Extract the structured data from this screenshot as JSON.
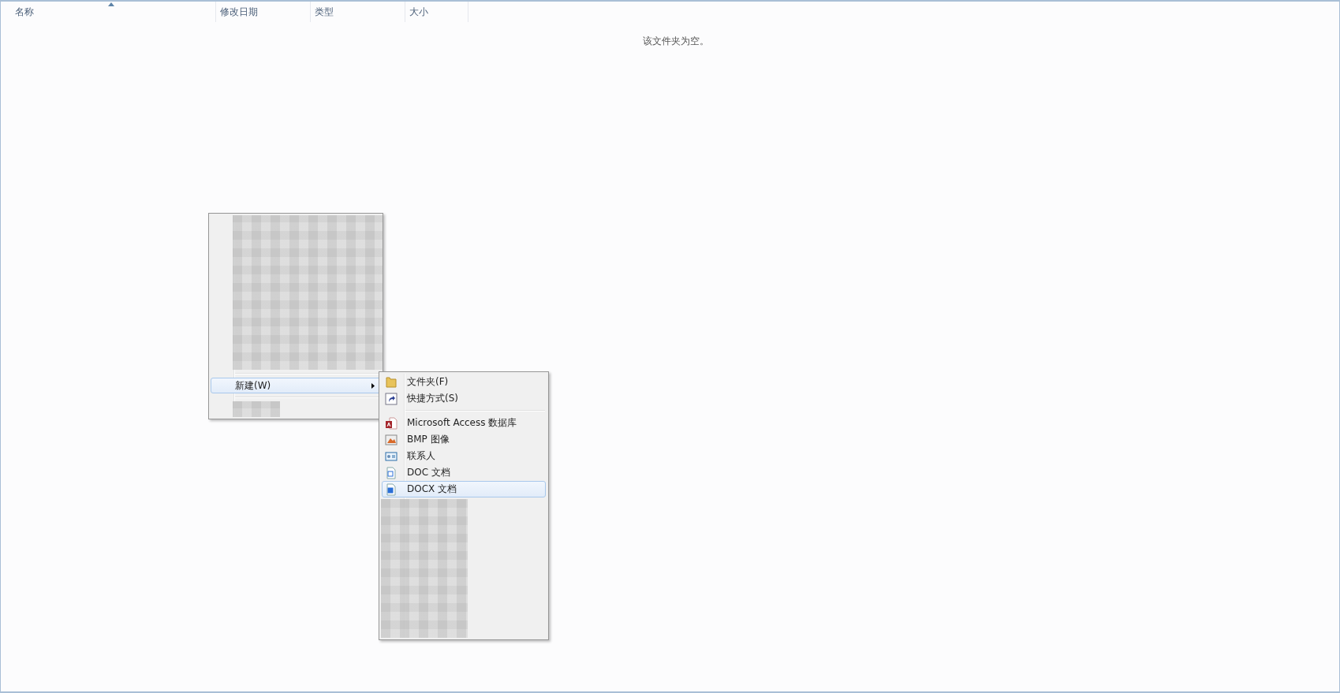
{
  "columns": [
    {
      "label": "名称",
      "sorted": true
    },
    {
      "label": "修改日期",
      "sorted": false
    },
    {
      "label": "类型",
      "sorted": false
    },
    {
      "label": "大小",
      "sorted": false
    }
  ],
  "empty_message": "该文件夹为空。",
  "context_menu": {
    "items": [
      {
        "label": "新建(W)",
        "selected": true,
        "has_submenu": true
      }
    ]
  },
  "submenu": {
    "groups": [
      [
        {
          "label": "文件夹(F)",
          "kind": "folder",
          "selected": false
        },
        {
          "label": "快捷方式(S)",
          "kind": "shortcut",
          "selected": false
        }
      ],
      [
        {
          "label": "Microsoft Access 数据库",
          "kind": "access",
          "selected": false
        },
        {
          "label": "BMP 图像",
          "kind": "bmp",
          "selected": false
        },
        {
          "label": "联系人",
          "kind": "contact",
          "selected": false
        },
        {
          "label": "DOC 文档",
          "kind": "doc",
          "selected": false
        },
        {
          "label": "DOCX 文档",
          "kind": "docx",
          "selected": true
        }
      ]
    ]
  }
}
